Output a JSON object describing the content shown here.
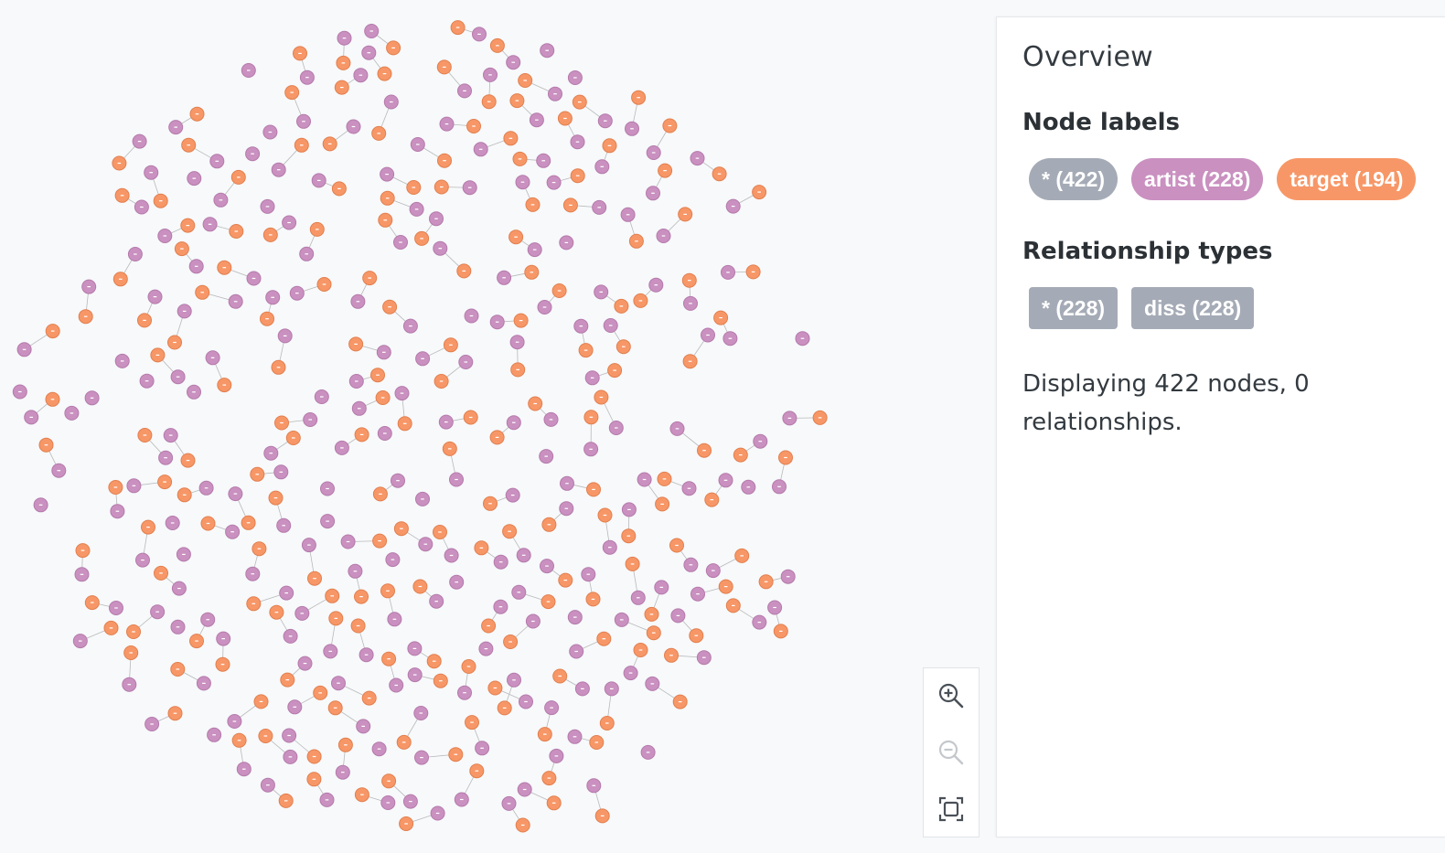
{
  "overview": {
    "title": "Overview",
    "node_labels_heading": "Node labels",
    "node_labels": [
      {
        "label": "* (422)",
        "color": "#a5abb6"
      },
      {
        "label": "artist (228)",
        "color": "#c990c0"
      },
      {
        "label": "target (194)",
        "color": "#f79767"
      }
    ],
    "relationship_types_heading": "Relationship types",
    "relationship_types": [
      {
        "label": "* (228)",
        "color": "#a5abb6"
      },
      {
        "label": "diss (228)",
        "color": "#a5abb6"
      }
    ],
    "status": "Displaying 422 nodes, 0 relationships."
  },
  "graph": {
    "node_count": 422,
    "relationship_count": 0,
    "artist_count": 228,
    "target_count": 194,
    "colors": {
      "artist": "#c990c0",
      "target": "#f79767",
      "edge": "#b9b9b9"
    }
  },
  "zoom_controls": {
    "zoom_in_icon": "zoom-in-icon",
    "zoom_out_icon": "zoom-out-icon",
    "fit_icon": "fit-to-screen-icon"
  }
}
